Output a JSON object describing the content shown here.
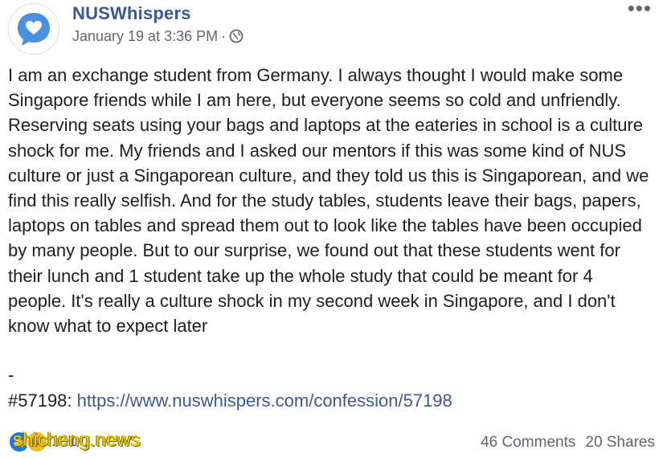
{
  "header": {
    "page_name": "NUSWhispers",
    "timestamp": "January 19 at 3:36 PM",
    "separator": "·",
    "audience_icon": "globe-icon",
    "more_label": "•••",
    "avatar_icon": "chat-bubble-heart-icon"
  },
  "post": {
    "body": "I am an exchange student from Germany. I always thought I would make some Singapore friends while I am here, but everyone seems so cold and unfriendly. Reserving seats using your bags and laptops at the eateries in school is a culture shock for me. My friends and I asked our mentors if this was some kind of NUS culture or just a Singaporean culture, and they told us this is Singaporean, and we find this really selfish. And for the study tables, students leave their bags, papers, laptops on tables and spread them out to look like the tables have been occupied by many people. But to our surprise, we found out that these students went for their lunch and 1 student take up the whole study that could be meant for 4 people. It's really a culture shock in my second week in Singapore, and I don't know what to expect later",
    "separator_line": "-",
    "tag": "#57198",
    "tag_colon": ": ",
    "link": "https://www.nuswhispers.com/confession/57198"
  },
  "footer": {
    "reaction_count": "131",
    "watermark": "shicheng.news",
    "comments": "46 Comments",
    "shares": "20 Shares"
  },
  "colors": {
    "brand_blue": "#385898",
    "avatar_blue": "#4a90e2",
    "text": "#1c1e21",
    "muted": "#606770",
    "watermark": "#f5d400"
  }
}
